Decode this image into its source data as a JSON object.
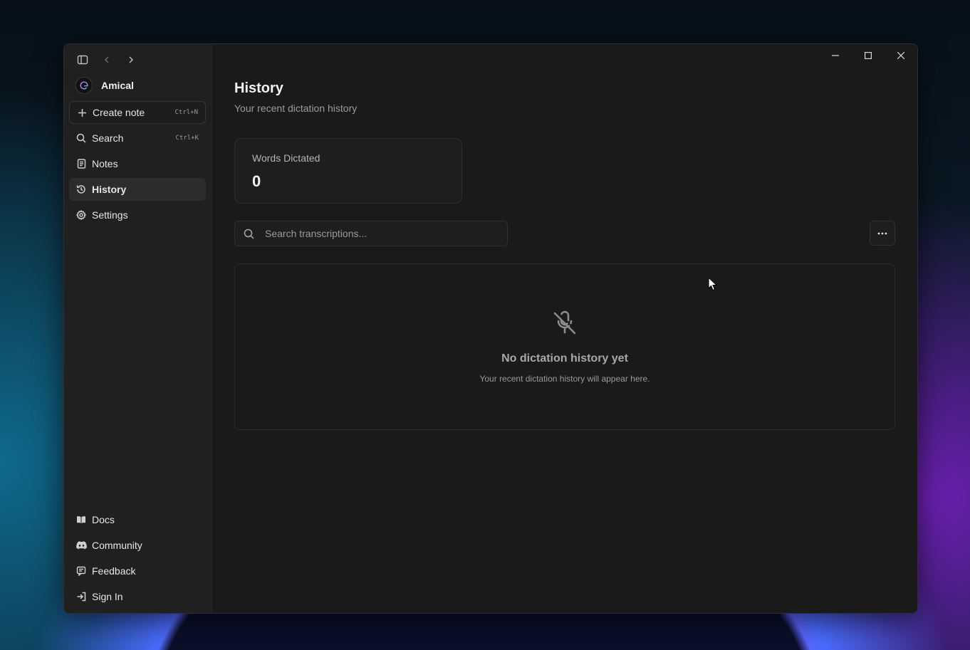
{
  "app": {
    "name": "Amical"
  },
  "sidebar": {
    "items": [
      {
        "label": "Create note",
        "shortcut": "Ctrl+N",
        "icon": "plus-icon"
      },
      {
        "label": "Search",
        "shortcut": "Ctrl+K",
        "icon": "search-icon"
      },
      {
        "label": "Notes",
        "icon": "notes-icon"
      },
      {
        "label": "History",
        "icon": "history-icon",
        "active": true
      },
      {
        "label": "Settings",
        "icon": "gear-icon"
      }
    ],
    "footer_items": [
      {
        "label": "Docs",
        "icon": "book-icon"
      },
      {
        "label": "Community",
        "icon": "discord-icon"
      },
      {
        "label": "Feedback",
        "icon": "feedback-icon"
      },
      {
        "label": "Sign In",
        "icon": "sign-in-icon"
      }
    ]
  },
  "main": {
    "title": "History",
    "subtitle": "Your recent dictation history",
    "stat": {
      "label": "Words Dictated",
      "value": "0"
    },
    "search": {
      "placeholder": "Search transcriptions..."
    },
    "empty_state": {
      "icon": "mic-off-icon",
      "title": "No dictation history yet",
      "description": "Your recent dictation history will appear here."
    }
  },
  "colors": {
    "window_bg": "#1a1a1a",
    "sidebar_bg": "#202020",
    "active_item_bg": "#2c2c2c",
    "text_primary": "#f2f2f2",
    "text_muted": "#9b9b9b"
  }
}
